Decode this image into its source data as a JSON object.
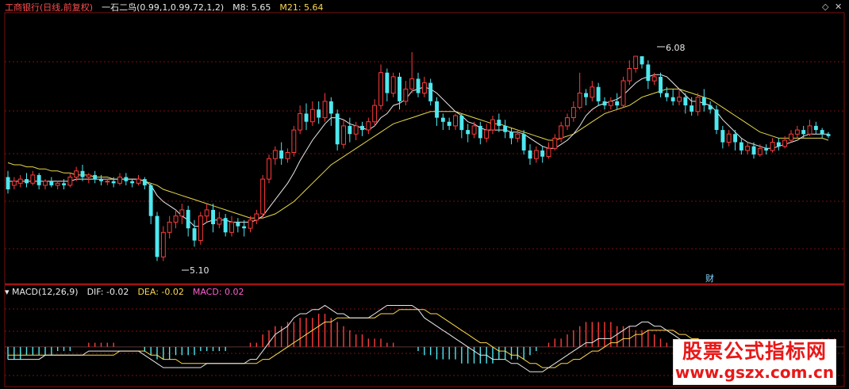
{
  "header": {
    "symbol_label": "工商银行(日线,前复权)",
    "indicator_label": "一石二鸟(0.99,1,0.99,72,1,2)",
    "m8_label": "M8: 5.65",
    "m21_label": "M21: 5.64"
  },
  "macd_header": {
    "title": "MACD(12,26,9)",
    "dif_label": "DIF: -0.02",
    "dea_label": "DEA: -0.02",
    "macd_label": "MACD: 0.02"
  },
  "annotations": {
    "low_label": "5.10",
    "high_label": "6.08",
    "event_marker": "财"
  },
  "window_controls": {
    "restore_icon": "diamond-icon",
    "close_icon": "close-icon"
  },
  "watermark": {
    "line1": "股票公式指标网",
    "line2": "www.gszx.com.cn"
  },
  "colors": {
    "up": "#ff3b3b",
    "down": "#4ee8f0",
    "ma8": "#e8e8e8",
    "ma21": "#e8d84a",
    "dif": "#e8e8e8",
    "dea": "#ffd84a",
    "grid": "#7a1010"
  },
  "chart_data": {
    "type": "candlestick",
    "price_range": [
      5.02,
      6.2
    ],
    "macd_range": [
      -0.09,
      0.12
    ],
    "candles": [
      [
        5.49,
        5.43,
        5.52,
        5.41
      ],
      [
        5.45,
        5.47,
        5.49,
        5.43
      ],
      [
        5.46,
        5.48,
        5.5,
        5.44
      ],
      [
        5.48,
        5.46,
        5.51,
        5.44
      ],
      [
        5.46,
        5.5,
        5.52,
        5.45
      ],
      [
        5.5,
        5.45,
        5.51,
        5.43
      ],
      [
        5.45,
        5.47,
        5.48,
        5.43
      ],
      [
        5.47,
        5.45,
        5.49,
        5.44
      ],
      [
        5.45,
        5.46,
        5.47,
        5.43
      ],
      [
        5.46,
        5.45,
        5.48,
        5.43
      ],
      [
        5.45,
        5.49,
        5.51,
        5.44
      ],
      [
        5.49,
        5.52,
        5.54,
        5.47
      ],
      [
        5.52,
        5.49,
        5.55,
        5.47
      ],
      [
        5.49,
        5.5,
        5.51,
        5.46
      ],
      [
        5.5,
        5.48,
        5.52,
        5.46
      ],
      [
        5.48,
        5.47,
        5.5,
        5.45
      ],
      [
        5.47,
        5.47,
        5.48,
        5.45
      ],
      [
        5.47,
        5.46,
        5.49,
        5.44
      ],
      [
        5.46,
        5.49,
        5.51,
        5.45
      ],
      [
        5.49,
        5.47,
        5.51,
        5.45
      ],
      [
        5.47,
        5.46,
        5.48,
        5.44
      ],
      [
        5.46,
        5.48,
        5.5,
        5.45
      ],
      [
        5.48,
        5.45,
        5.49,
        5.43
      ],
      [
        5.45,
        5.3,
        5.46,
        5.26
      ],
      [
        5.3,
        5.1,
        5.32,
        5.08
      ],
      [
        5.1,
        5.22,
        5.25,
        5.08
      ],
      [
        5.22,
        5.27,
        5.3,
        5.19
      ],
      [
        5.27,
        5.3,
        5.33,
        5.24
      ],
      [
        5.3,
        5.33,
        5.36,
        5.26
      ],
      [
        5.33,
        5.24,
        5.35,
        5.2
      ],
      [
        5.24,
        5.18,
        5.28,
        5.15
      ],
      [
        5.18,
        5.3,
        5.32,
        5.16
      ],
      [
        5.3,
        5.33,
        5.36,
        5.27
      ],
      [
        5.33,
        5.26,
        5.36,
        5.22
      ],
      [
        5.26,
        5.29,
        5.32,
        5.24
      ],
      [
        5.29,
        5.22,
        5.31,
        5.2
      ],
      [
        5.22,
        5.27,
        5.3,
        5.2
      ],
      [
        5.27,
        5.25,
        5.29,
        5.22
      ],
      [
        5.25,
        5.24,
        5.28,
        5.2
      ],
      [
        5.24,
        5.28,
        5.3,
        5.22
      ],
      [
        5.28,
        5.31,
        5.33,
        5.26
      ],
      [
        5.31,
        5.48,
        5.5,
        5.29
      ],
      [
        5.48,
        5.58,
        5.6,
        5.46
      ],
      [
        5.58,
        5.62,
        5.64,
        5.55
      ],
      [
        5.62,
        5.58,
        5.66,
        5.55
      ],
      [
        5.58,
        5.61,
        5.63,
        5.56
      ],
      [
        5.61,
        5.72,
        5.74,
        5.59
      ],
      [
        5.72,
        5.8,
        5.84,
        5.7
      ],
      [
        5.8,
        5.76,
        5.85,
        5.72
      ],
      [
        5.76,
        5.82,
        5.86,
        5.74
      ],
      [
        5.82,
        5.78,
        5.86,
        5.75
      ],
      [
        5.78,
        5.86,
        5.9,
        5.76
      ],
      [
        5.86,
        5.8,
        5.88,
        5.74
      ],
      [
        5.8,
        5.65,
        5.82,
        5.62
      ],
      [
        5.65,
        5.74,
        5.77,
        5.63
      ],
      [
        5.74,
        5.7,
        5.78,
        5.66
      ],
      [
        5.7,
        5.74,
        5.76,
        5.67
      ],
      [
        5.74,
        5.72,
        5.76,
        5.69
      ],
      [
        5.72,
        5.76,
        5.78,
        5.7
      ],
      [
        5.76,
        5.84,
        5.87,
        5.74
      ],
      [
        5.84,
        6.0,
        6.04,
        5.82
      ],
      [
        6.0,
        5.9,
        6.02,
        5.86
      ],
      [
        5.9,
        5.98,
        6.0,
        5.88
      ],
      [
        5.98,
        5.86,
        6.0,
        5.82
      ],
      [
        5.86,
        5.92,
        5.96,
        5.84
      ],
      [
        5.92,
        5.97,
        6.1,
        5.9
      ],
      [
        5.97,
        5.9,
        6.0,
        5.88
      ],
      [
        5.9,
        5.95,
        5.98,
        5.88
      ],
      [
        5.95,
        5.86,
        5.97,
        5.84
      ],
      [
        5.86,
        5.78,
        5.88,
        5.74
      ],
      [
        5.78,
        5.76,
        5.8,
        5.72
      ],
      [
        5.76,
        5.74,
        5.78,
        5.72
      ],
      [
        5.74,
        5.79,
        5.8,
        5.72
      ],
      [
        5.79,
        5.72,
        5.8,
        5.68
      ],
      [
        5.72,
        5.7,
        5.75,
        5.66
      ],
      [
        5.7,
        5.74,
        5.76,
        5.68
      ],
      [
        5.74,
        5.68,
        5.76,
        5.65
      ],
      [
        5.68,
        5.72,
        5.75,
        5.66
      ],
      [
        5.72,
        5.77,
        5.79,
        5.7
      ],
      [
        5.77,
        5.74,
        5.8,
        5.71
      ],
      [
        5.74,
        5.71,
        5.77,
        5.68
      ],
      [
        5.71,
        5.68,
        5.73,
        5.65
      ],
      [
        5.68,
        5.7,
        5.72,
        5.66
      ],
      [
        5.7,
        5.62,
        5.72,
        5.6
      ],
      [
        5.62,
        5.58,
        5.65,
        5.55
      ],
      [
        5.58,
        5.62,
        5.64,
        5.56
      ],
      [
        5.62,
        5.59,
        5.64,
        5.56
      ],
      [
        5.59,
        5.63,
        5.66,
        5.58
      ],
      [
        5.63,
        5.68,
        5.7,
        5.62
      ],
      [
        5.68,
        5.74,
        5.76,
        5.66
      ],
      [
        5.74,
        5.78,
        5.8,
        5.72
      ],
      [
        5.78,
        5.83,
        5.86,
        5.76
      ],
      [
        5.83,
        5.9,
        6.0,
        5.82
      ],
      [
        5.9,
        5.88,
        5.92,
        5.84
      ],
      [
        5.88,
        5.93,
        5.96,
        5.86
      ],
      [
        5.93,
        5.86,
        5.95,
        5.84
      ],
      [
        5.86,
        5.84,
        5.88,
        5.82
      ],
      [
        5.84,
        5.86,
        5.88,
        5.82
      ],
      [
        5.86,
        5.84,
        5.9,
        5.82
      ],
      [
        5.84,
        5.96,
        5.98,
        5.83
      ],
      [
        5.96,
        6.02,
        6.06,
        5.94
      ],
      [
        6.02,
        6.08,
        6.08,
        6.0
      ],
      [
        6.08,
        6.04,
        6.08,
        6.02
      ],
      [
        6.04,
        5.96,
        6.06,
        5.92
      ],
      [
        5.96,
        5.98,
        6.0,
        5.94
      ],
      [
        5.98,
        5.9,
        6.0,
        5.88
      ],
      [
        5.9,
        5.88,
        5.93,
        5.86
      ],
      [
        5.88,
        5.86,
        5.92,
        5.84
      ],
      [
        5.86,
        5.88,
        5.92,
        5.84
      ],
      [
        5.88,
        5.84,
        5.9,
        5.8
      ],
      [
        5.84,
        5.81,
        5.88,
        5.79
      ],
      [
        5.81,
        5.88,
        5.9,
        5.79
      ],
      [
        5.88,
        5.84,
        5.92,
        5.81
      ],
      [
        5.84,
        5.82,
        5.86,
        5.8
      ],
      [
        5.82,
        5.72,
        5.84,
        5.7
      ],
      [
        5.72,
        5.66,
        5.74,
        5.63
      ],
      [
        5.66,
        5.7,
        5.72,
        5.64
      ],
      [
        5.7,
        5.66,
        5.72,
        5.62
      ],
      [
        5.66,
        5.62,
        5.68,
        5.6
      ],
      [
        5.62,
        5.64,
        5.66,
        5.6
      ],
      [
        5.64,
        5.6,
        5.66,
        5.58
      ],
      [
        5.6,
        5.63,
        5.65,
        5.59
      ],
      [
        5.63,
        5.62,
        5.65,
        5.6
      ],
      [
        5.62,
        5.66,
        5.68,
        5.61
      ],
      [
        5.66,
        5.64,
        5.68,
        5.62
      ],
      [
        5.64,
        5.67,
        5.69,
        5.63
      ],
      [
        5.67,
        5.7,
        5.72,
        5.66
      ],
      [
        5.7,
        5.72,
        5.74,
        5.68
      ],
      [
        5.72,
        5.7,
        5.74,
        5.68
      ],
      [
        5.7,
        5.74,
        5.77,
        5.69
      ],
      [
        5.74,
        5.72,
        5.76,
        5.7
      ],
      [
        5.72,
        5.7,
        5.73,
        5.68
      ],
      [
        5.7,
        5.69,
        5.71,
        5.68
      ]
    ],
    "ma8": [
      5.47,
      5.47,
      5.47,
      5.47,
      5.47,
      5.47,
      5.47,
      5.47,
      5.47,
      5.47,
      5.47,
      5.48,
      5.48,
      5.48,
      5.48,
      5.48,
      5.48,
      5.48,
      5.48,
      5.48,
      5.48,
      5.48,
      5.47,
      5.45,
      5.4,
      5.37,
      5.35,
      5.33,
      5.3,
      5.28,
      5.25,
      5.25,
      5.27,
      5.28,
      5.28,
      5.28,
      5.27,
      5.27,
      5.27,
      5.27,
      5.28,
      5.3,
      5.34,
      5.38,
      5.42,
      5.46,
      5.51,
      5.57,
      5.62,
      5.67,
      5.71,
      5.75,
      5.78,
      5.78,
      5.77,
      5.75,
      5.74,
      5.73,
      5.72,
      5.74,
      5.78,
      5.8,
      5.84,
      5.85,
      5.87,
      5.91,
      5.92,
      5.93,
      5.92,
      5.9,
      5.87,
      5.84,
      5.81,
      5.79,
      5.76,
      5.75,
      5.73,
      5.72,
      5.72,
      5.72,
      5.72,
      5.71,
      5.71,
      5.7,
      5.68,
      5.66,
      5.64,
      5.63,
      5.63,
      5.65,
      5.67,
      5.7,
      5.74,
      5.79,
      5.82,
      5.84,
      5.85,
      5.86,
      5.87,
      5.89,
      5.92,
      5.95,
      5.97,
      5.98,
      5.99,
      5.99,
      5.98,
      5.95,
      5.92,
      5.89,
      5.86,
      5.86,
      5.85,
      5.84,
      5.81,
      5.77,
      5.74,
      5.71,
      5.68,
      5.66,
      5.65,
      5.64,
      5.63,
      5.63,
      5.64,
      5.65,
      5.66,
      5.67,
      5.69,
      5.7,
      5.7,
      5.7,
      5.7
    ],
    "ma21": [
      5.56,
      5.55,
      5.55,
      5.54,
      5.54,
      5.53,
      5.53,
      5.52,
      5.52,
      5.51,
      5.51,
      5.5,
      5.5,
      5.5,
      5.49,
      5.49,
      5.49,
      5.48,
      5.48,
      5.48,
      5.48,
      5.48,
      5.47,
      5.46,
      5.45,
      5.43,
      5.42,
      5.41,
      5.4,
      5.39,
      5.38,
      5.37,
      5.36,
      5.35,
      5.34,
      5.33,
      5.32,
      5.31,
      5.3,
      5.29,
      5.29,
      5.29,
      5.3,
      5.31,
      5.33,
      5.35,
      5.37,
      5.4,
      5.43,
      5.46,
      5.49,
      5.52,
      5.55,
      5.57,
      5.59,
      5.61,
      5.63,
      5.65,
      5.67,
      5.69,
      5.71,
      5.73,
      5.75,
      5.76,
      5.77,
      5.78,
      5.79,
      5.8,
      5.81,
      5.81,
      5.81,
      5.81,
      5.81,
      5.8,
      5.79,
      5.78,
      5.77,
      5.76,
      5.75,
      5.75,
      5.74,
      5.73,
      5.72,
      5.71,
      5.7,
      5.69,
      5.68,
      5.67,
      5.67,
      5.68,
      5.69,
      5.7,
      5.72,
      5.74,
      5.76,
      5.78,
      5.8,
      5.81,
      5.82,
      5.83,
      5.84,
      5.86,
      5.88,
      5.89,
      5.9,
      5.91,
      5.92,
      5.92,
      5.92,
      5.91,
      5.9,
      5.89,
      5.88,
      5.87,
      5.85,
      5.83,
      5.81,
      5.79,
      5.77,
      5.75,
      5.73,
      5.71,
      5.7,
      5.69,
      5.68,
      5.68,
      5.68,
      5.68,
      5.68,
      5.68,
      5.68,
      5.68,
      5.67
    ],
    "macd_hist": [
      -0.03,
      -0.03,
      -0.03,
      -0.02,
      -0.02,
      -0.02,
      -0.02,
      -0.02,
      -0.01,
      -0.01,
      -0.01,
      0.0,
      0.0,
      0.01,
      0.01,
      0.01,
      0.01,
      0.01,
      0.0,
      0.0,
      0.0,
      0.0,
      -0.01,
      -0.02,
      -0.03,
      -0.03,
      -0.03,
      -0.02,
      -0.02,
      -0.02,
      -0.02,
      -0.01,
      -0.01,
      -0.01,
      -0.01,
      -0.01,
      -0.0,
      0.0,
      0.0,
      0.01,
      0.01,
      0.03,
      0.04,
      0.05,
      0.05,
      0.06,
      0.06,
      0.07,
      0.07,
      0.07,
      0.08,
      0.08,
      0.07,
      0.06,
      0.05,
      0.04,
      0.03,
      0.03,
      0.02,
      0.02,
      0.02,
      0.01,
      0.01,
      0.0,
      0.0,
      0.0,
      -0.01,
      -0.02,
      -0.02,
      -0.03,
      -0.03,
      -0.03,
      -0.03,
      -0.04,
      -0.04,
      -0.04,
      -0.04,
      -0.04,
      -0.04,
      -0.03,
      -0.03,
      -0.03,
      -0.03,
      -0.03,
      -0.02,
      -0.01,
      0.0,
      0.01,
      0.02,
      0.02,
      0.03,
      0.04,
      0.05,
      0.06,
      0.06,
      0.06,
      0.06,
      0.06,
      0.05,
      0.05,
      0.05,
      0.04,
      0.04,
      0.04,
      0.03,
      0.02,
      0.01,
      0.0,
      -0.01,
      -0.01,
      -0.02,
      -0.02,
      -0.02,
      -0.03,
      -0.03,
      -0.03,
      -0.03,
      -0.03,
      -0.03,
      -0.02,
      -0.02,
      -0.02,
      -0.02,
      -0.01,
      -0.01,
      -0.01,
      -0.01,
      0.0,
      0.0,
      0.01,
      0.01,
      0.02,
      0.02,
      0.02
    ],
    "dif": [
      -0.03,
      -0.03,
      -0.03,
      -0.03,
      -0.03,
      -0.03,
      -0.02,
      -0.02,
      -0.02,
      -0.02,
      -0.02,
      -0.02,
      -0.02,
      -0.01,
      -0.01,
      -0.01,
      -0.01,
      -0.01,
      -0.01,
      -0.01,
      -0.01,
      -0.01,
      -0.02,
      -0.03,
      -0.04,
      -0.05,
      -0.05,
      -0.05,
      -0.05,
      -0.05,
      -0.05,
      -0.05,
      -0.04,
      -0.04,
      -0.04,
      -0.04,
      -0.04,
      -0.04,
      -0.04,
      -0.03,
      -0.03,
      -0.01,
      0.01,
      0.03,
      0.04,
      0.05,
      0.07,
      0.08,
      0.08,
      0.09,
      0.09,
      0.1,
      0.09,
      0.08,
      0.08,
      0.07,
      0.07,
      0.07,
      0.07,
      0.08,
      0.09,
      0.1,
      0.1,
      0.1,
      0.1,
      0.1,
      0.09,
      0.07,
      0.06,
      0.05,
      0.04,
      0.03,
      0.02,
      0.01,
      0.0,
      -0.01,
      -0.02,
      -0.02,
      -0.03,
      -0.03,
      -0.03,
      -0.04,
      -0.04,
      -0.05,
      -0.06,
      -0.06,
      -0.06,
      -0.05,
      -0.04,
      -0.03,
      -0.02,
      -0.01,
      0.0,
      0.01,
      0.01,
      0.02,
      0.02,
      0.02,
      0.03,
      0.04,
      0.05,
      0.05,
      0.06,
      0.06,
      0.05,
      0.05,
      0.04,
      0.03,
      0.02,
      0.01,
      0.0,
      0.0,
      -0.01,
      -0.02,
      -0.03,
      -0.04,
      -0.04,
      -0.05,
      -0.05,
      -0.05,
      -0.05,
      -0.05,
      -0.04,
      -0.04,
      -0.04,
      -0.03,
      -0.03,
      -0.02,
      -0.02,
      -0.02,
      -0.02,
      -0.02,
      -0.02
    ],
    "dea": [
      -0.02,
      -0.02,
      -0.02,
      -0.02,
      -0.02,
      -0.02,
      -0.02,
      -0.02,
      -0.02,
      -0.02,
      -0.02,
      -0.02,
      -0.02,
      -0.02,
      -0.02,
      -0.02,
      -0.02,
      -0.02,
      -0.01,
      -0.01,
      -0.01,
      -0.01,
      -0.01,
      -0.02,
      -0.02,
      -0.03,
      -0.03,
      -0.03,
      -0.04,
      -0.04,
      -0.04,
      -0.04,
      -0.04,
      -0.04,
      -0.04,
      -0.04,
      -0.04,
      -0.04,
      -0.04,
      -0.04,
      -0.04,
      -0.03,
      -0.03,
      -0.02,
      -0.01,
      0.0,
      0.01,
      0.02,
      0.03,
      0.04,
      0.05,
      0.06,
      0.06,
      0.07,
      0.07,
      0.07,
      0.07,
      0.07,
      0.07,
      0.07,
      0.08,
      0.08,
      0.08,
      0.09,
      0.09,
      0.09,
      0.09,
      0.09,
      0.08,
      0.08,
      0.07,
      0.06,
      0.05,
      0.04,
      0.03,
      0.02,
      0.01,
      0.01,
      0.0,
      -0.01,
      -0.01,
      -0.02,
      -0.02,
      -0.03,
      -0.04,
      -0.04,
      -0.05,
      -0.05,
      -0.05,
      -0.04,
      -0.04,
      -0.03,
      -0.03,
      -0.02,
      -0.01,
      -0.01,
      0.0,
      0.01,
      0.01,
      0.02,
      0.02,
      0.03,
      0.03,
      0.04,
      0.04,
      0.04,
      0.04,
      0.04,
      0.03,
      0.03,
      0.02,
      0.02,
      0.01,
      0.0,
      0.0,
      -0.01,
      -0.02,
      -0.02,
      -0.03,
      -0.03,
      -0.03,
      -0.04,
      -0.04,
      -0.04,
      -0.04,
      -0.04,
      -0.03,
      -0.03,
      -0.03,
      -0.03,
      -0.02,
      -0.02,
      -0.02
    ]
  }
}
